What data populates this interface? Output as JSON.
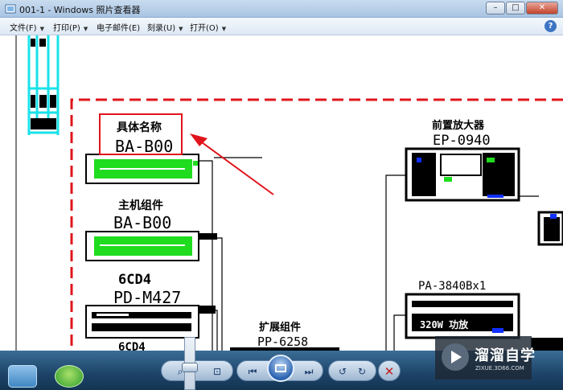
{
  "window": {
    "title": "001-1 - Windows 照片查看器",
    "buttons": {
      "minimize": "–",
      "maximize": "□",
      "close": "✕"
    }
  },
  "menubar": {
    "items": [
      {
        "label": "文件(F)",
        "has_arrow": true
      },
      {
        "label": "打印(P)",
        "has_arrow": true
      },
      {
        "label": "电子邮件(E)",
        "has_arrow": false
      },
      {
        "label": "刻录(U)",
        "has_arrow": true
      },
      {
        "label": "打开(O)",
        "has_arrow": true
      }
    ],
    "arrow_glyph": "▼",
    "help": "?"
  },
  "drawing": {
    "labels": {
      "unit_a_name": "具体名称",
      "unit_a_model": "BA-B00",
      "unit_b_name": "主机组件",
      "unit_b_model": "BA-B00",
      "unit_c_name": "6CD4",
      "unit_c_model": "PD-M427",
      "unit_d_name": "6CD4",
      "unit_e_name": "扩展组件",
      "unit_e_model": "PP-6258",
      "unit_f_name": "前置放大器",
      "unit_f_model": "EP-0940",
      "unit_g_model": "PA-3840Bx1",
      "unit_g_panel": "320W 功放"
    },
    "colors": {
      "frame": "#e0141b",
      "highlight_box": "#e0141b",
      "arrow": "#e0141b",
      "panel_green": "#1fdc1f",
      "cyan_grid": "#19e2ea",
      "accent_blue": "#1030ff"
    }
  },
  "controls": {
    "icons": [
      "zoom-icon",
      "actual-size-icon",
      "previous-icon",
      "slideshow-icon",
      "next-icon",
      "rotate-left-icon",
      "rotate-right-icon",
      "delete-icon"
    ],
    "glyphs": {
      "zoom": "⌕",
      "actual_size": "⊡",
      "previous": "⏮",
      "next": "⏭",
      "rotate_left": "↺",
      "rotate_right": "↻",
      "delete": "✕"
    }
  },
  "watermark": {
    "title": "溜溜自学",
    "url": "ZIXUE.3D66.COM"
  }
}
